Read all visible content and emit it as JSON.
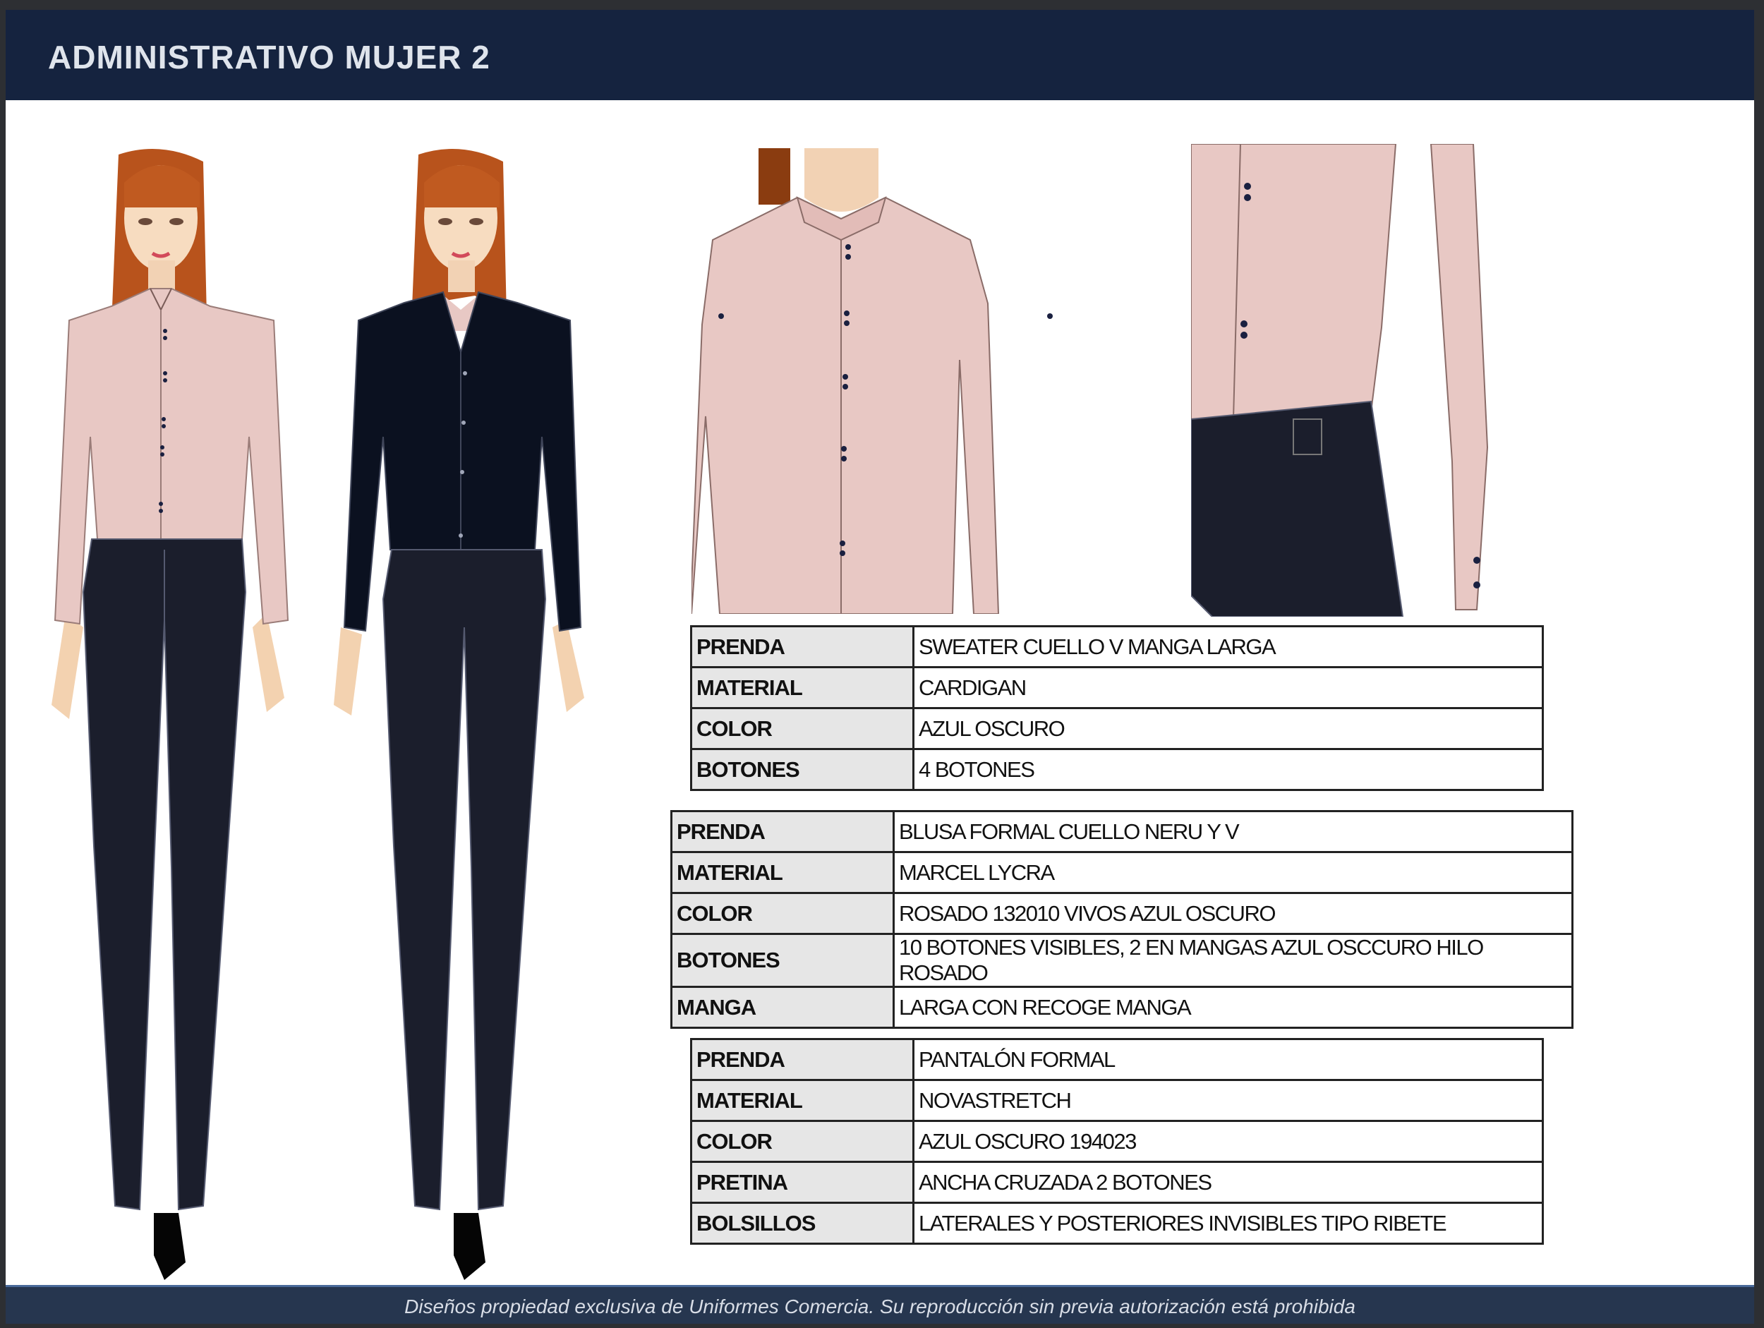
{
  "header": {
    "title": "ADMINISTRATIVO MUJER 2"
  },
  "footer": {
    "notice": "Diseños propiedad exclusiva de Uniformes Comercia. Su reproducción sin previa autorización está prohibida"
  },
  "colors": {
    "header_bg": "#15233f",
    "blouse_pink": "#e8c8c4",
    "cardigan_navy": "#0b1120",
    "pants_navy": "#1b1e2c",
    "hair": "#b8531c"
  },
  "tables": [
    {
      "rows": [
        {
          "label": "PRENDA",
          "value": "SWEATER CUELLO V MANGA LARGA"
        },
        {
          "label": "MATERIAL",
          "value": "CARDIGAN"
        },
        {
          "label": "COLOR",
          "value": "AZUL OSCURO"
        },
        {
          "label": "BOTONES",
          "value": "4 BOTONES"
        }
      ]
    },
    {
      "rows": [
        {
          "label": "PRENDA",
          "value": "BLUSA FORMAL CUELLO NERU Y V"
        },
        {
          "label": "MATERIAL",
          "value": "MARCEL LYCRA"
        },
        {
          "label": "COLOR",
          "value": "ROSADO 132010 VIVOS AZUL OSCURO"
        },
        {
          "label": "BOTONES",
          "value": "10 BOTONES VISIBLES, 2 EN MANGAS AZUL OSCCURO HILO ROSADO"
        },
        {
          "label": "MANGA",
          "value": "LARGA CON RECOGE MANGA"
        }
      ]
    },
    {
      "rows": [
        {
          "label": "PRENDA",
          "value": "PANTALÓN FORMAL"
        },
        {
          "label": "MATERIAL",
          "value": "NOVASTRETCH"
        },
        {
          "label": "COLOR",
          "value": "AZUL OSCURO 194023"
        },
        {
          "label": "PRETINA",
          "value": "ANCHA CRUZADA 2 BOTONES"
        },
        {
          "label": "BOLSILLOS",
          "value": "LATERALES Y POSTERIORES INVISIBLES TIPO RIBETE"
        }
      ]
    }
  ]
}
